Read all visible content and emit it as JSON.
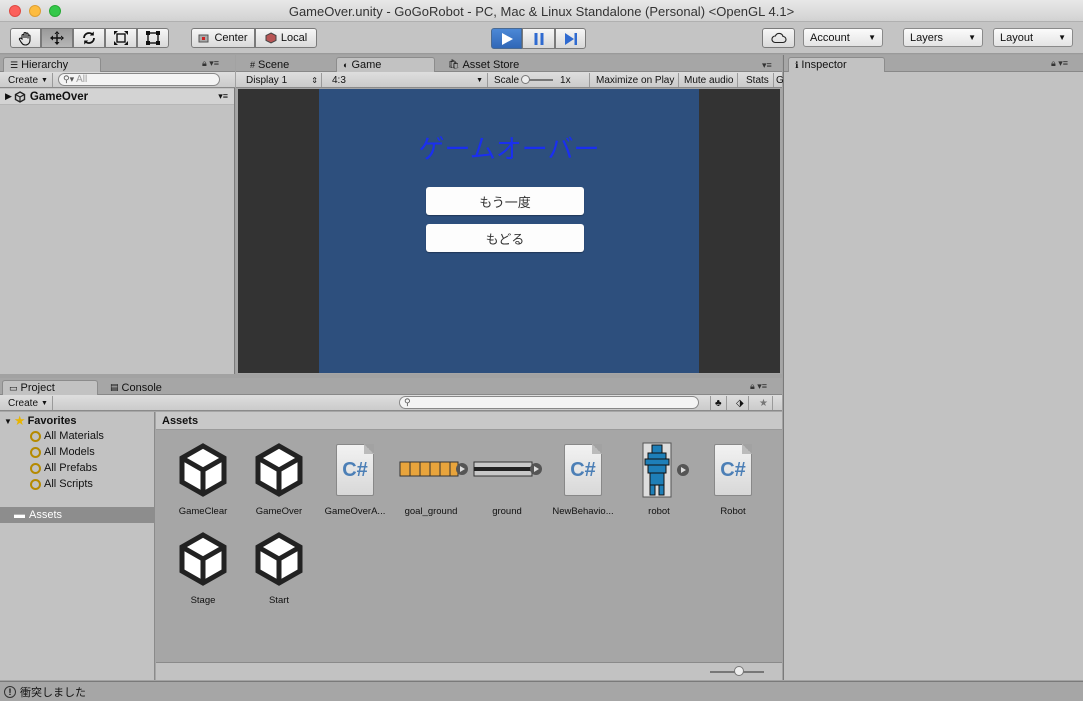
{
  "window": {
    "title": "GameOver.unity - GoGoRobot - PC, Mac & Linux Standalone (Personal) <OpenGL 4.1>"
  },
  "toolbar": {
    "tools": [
      "hand-tool",
      "move-tool",
      "rotate-tool",
      "scale-tool",
      "rect-tool"
    ],
    "pivot_label": "Center",
    "space_label": "Local",
    "account_label": "Account",
    "layers_label": "Layers",
    "layout_label": "Layout",
    "play_state": "playing"
  },
  "hierarchy": {
    "tab": "Hierarchy",
    "create_label": "Create",
    "search_placeholder": "All",
    "scene_name": "GameOver"
  },
  "center_tabs": [
    "Scene",
    "Game",
    "Asset Store"
  ],
  "game_view": {
    "display": "Display 1",
    "aspect": "4:3",
    "scale_label": "Scale",
    "scale_value": "1x",
    "maximize_label": "Maximize on Play",
    "mute_label": "Mute audio",
    "stats_label": "Stats",
    "gizmos_label": "G",
    "game_title": "ゲームオーバー",
    "retry_button": "もう一度",
    "back_button": "もどる",
    "colors": {
      "bg": "#2d4f7d",
      "title": "#1a2ff0",
      "letterbox": "#333333"
    }
  },
  "inspector": {
    "tab": "Inspector"
  },
  "project": {
    "tabs": [
      "Project",
      "Console"
    ],
    "create_label": "Create",
    "favorites_label": "Favorites",
    "favorites": [
      "All Materials",
      "All Models",
      "All Prefabs",
      "All Scripts"
    ],
    "folder_label": "Assets",
    "breadcrumb": "Assets",
    "assets": [
      {
        "name": "GameClear",
        "type": "unity-scene"
      },
      {
        "name": "GameOver",
        "type": "unity-scene"
      },
      {
        "name": "GameOverA...",
        "type": "csharp-script"
      },
      {
        "name": "goal_ground",
        "type": "sprite"
      },
      {
        "name": "ground",
        "type": "sprite"
      },
      {
        "name": "NewBehavio...",
        "type": "csharp-script"
      },
      {
        "name": "robot",
        "type": "sprite"
      },
      {
        "name": "Robot",
        "type": "csharp-script"
      },
      {
        "name": "Stage",
        "type": "unity-scene"
      },
      {
        "name": "Start",
        "type": "unity-scene"
      }
    ]
  },
  "status_bar": {
    "message": "衝突しました"
  }
}
